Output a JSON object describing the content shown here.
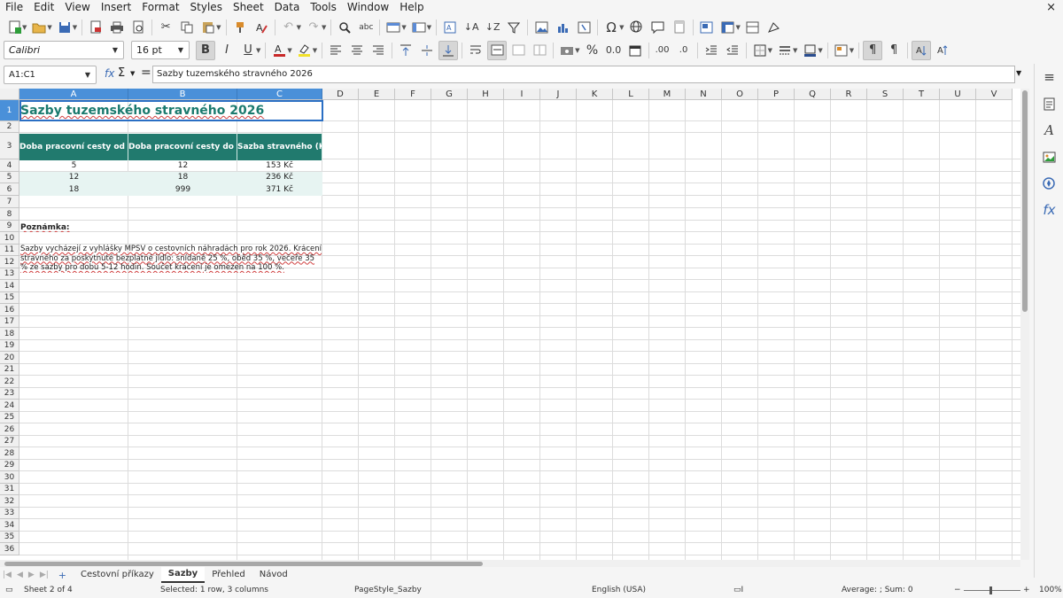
{
  "menubar": {
    "items": [
      "File",
      "Edit",
      "View",
      "Insert",
      "Format",
      "Styles",
      "Sheet",
      "Data",
      "Tools",
      "Window",
      "Help"
    ],
    "close": "×"
  },
  "toolbar": {
    "font_name": "Calibri",
    "font_size": "16 pt",
    "bold": "B",
    "italic": "I",
    "underline": "U"
  },
  "formula_bar": {
    "name_box": "A1:C1",
    "formula": "Sazby tuzemského stravného 2026"
  },
  "columns": [
    "A",
    "B",
    "C",
    "D",
    "E",
    "F",
    "G",
    "H",
    "I",
    "J",
    "K",
    "L",
    "M",
    "N",
    "O",
    "P",
    "Q",
    "R",
    "S",
    "T",
    "U",
    "V"
  ],
  "rows": [
    "1",
    "2",
    "3",
    "4",
    "5",
    "6",
    "7",
    "8",
    "9",
    "10",
    "11",
    "12",
    "13",
    "14",
    "15",
    "16",
    "17",
    "18",
    "19",
    "20",
    "21",
    "22",
    "23",
    "24",
    "25",
    "26",
    "27",
    "28",
    "29",
    "30",
    "31",
    "32",
    "33",
    "34",
    "35",
    "36"
  ],
  "sheet": {
    "title": "Sazby tuzemského stravného 2026",
    "headers": [
      "Doba pracovní cesty od (h)",
      "Doba pracovní cesty do (h)",
      "Sazba stravného (Kč)"
    ],
    "rows": [
      {
        "from": "5",
        "to": "12",
        "rate": "153 Kč"
      },
      {
        "from": "12",
        "to": "18",
        "rate": "236 Kč"
      },
      {
        "from": "18",
        "to": "999",
        "rate": "371 Kč"
      }
    ],
    "note_label": "Poznámka:",
    "note_text": "Sazby vycházejí z vyhlášky MPSV o cestovních náhradách pro rok 2026. Krácení stravného za poskytnuté bezplatné jídlo: snídaně 25 %, oběd 35 %, večeře 35 % ze sazby pro dobu 5-12 hodin. Součet krácení je omezen na 100 %."
  },
  "tabs": [
    "Cestovní příkazy",
    "Sazby",
    "Přehled",
    "Návod"
  ],
  "status": {
    "sheet": "Sheet 2 of 4",
    "selection": "Selected: 1 row, 3 columns",
    "page_style": "PageStyle_Sazby",
    "language": "English (USA)",
    "sum": "Average: ; Sum: 0",
    "zoom": "100%"
  },
  "colors": {
    "accent": "#217a6e",
    "title": "#1a7a6e",
    "selection": "#4a90d9"
  }
}
